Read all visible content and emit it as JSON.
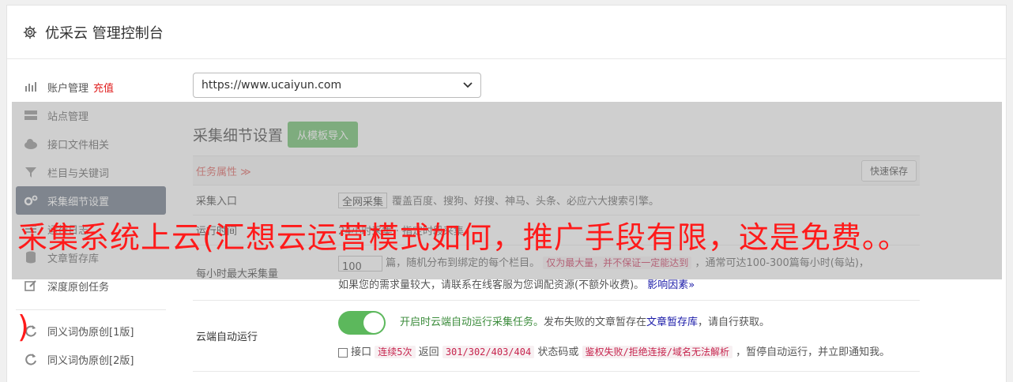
{
  "header": {
    "title": "优采云 管理控制台"
  },
  "sidebar": {
    "items": [
      {
        "label": "账户管理",
        "extra": "充值",
        "icon": "bar-chart-icon"
      },
      {
        "label": "站点管理",
        "icon": "server-icon"
      },
      {
        "label": "接口文件相关",
        "icon": "cloud-upload-icon"
      },
      {
        "label": "栏目与关键词",
        "icon": "filter-icon"
      },
      {
        "label": "采集细节设置",
        "icon": "gears-icon",
        "active": true
      },
      {
        "label": "运行日志",
        "icon": "list-icon"
      },
      {
        "label": "文章暂存库",
        "icon": "database-icon"
      },
      {
        "label": "深度原创任务",
        "icon": "edit-icon"
      },
      {
        "label": "同义词伪原创[1版]",
        "icon": "refresh-icon"
      },
      {
        "label": "同义词伪原创[2版]",
        "icon": "refresh-icon"
      }
    ]
  },
  "main": {
    "site_select": "https://www.ucaiyun.com",
    "section_title": "采集细节设置",
    "import_button": "从模板导入",
    "tab_label": "任务属性 ≫",
    "quick_save": "快速保存",
    "rows": {
      "entry": {
        "label": "采集入口",
        "select_value": "全网采集",
        "desc": "覆盖百度、搜狗、好搜、神马、头条、必应六大搜索引擎。"
      },
      "runtime": {
        "label": "运行时间",
        "desc": "24小时采集 · 指定时段采集"
      },
      "max_per_hour": {
        "label": "每小时最大采集量",
        "input_value": "100",
        "text1": "篇，随机分布到绑定的每个栏目。",
        "tag": "仅为最大量，并不保证一定能达到",
        "text2": "，通常可达100-300篇每小时(每站)，",
        "text3": "如果您的需求量较大，请联系在线客服为您调配资源(不额外收费)。",
        "link": "影响因素»"
      },
      "cloud_run": {
        "label": "云端自动运行",
        "green_text": "开启时云端自动运行采集任务。",
        "text1": "发布失败的文章暂存在",
        "link": "文章暂存库",
        "text2": "，请自行获取。",
        "cb_label": "接口",
        "tag1": "连续5次",
        "text3": "返回",
        "tag2": "301/302/403/404",
        "text4": "状态码或",
        "tag3": "鉴权失败/拒绝连接/域名无法解析",
        "text5": "，暂停自动运行，并立即通知我。"
      }
    }
  },
  "overlay": {
    "banner_text": "采集系统上云(汇想云运营模式如何，推广手段有限，这是免费。。",
    "paren_text": ")"
  }
}
